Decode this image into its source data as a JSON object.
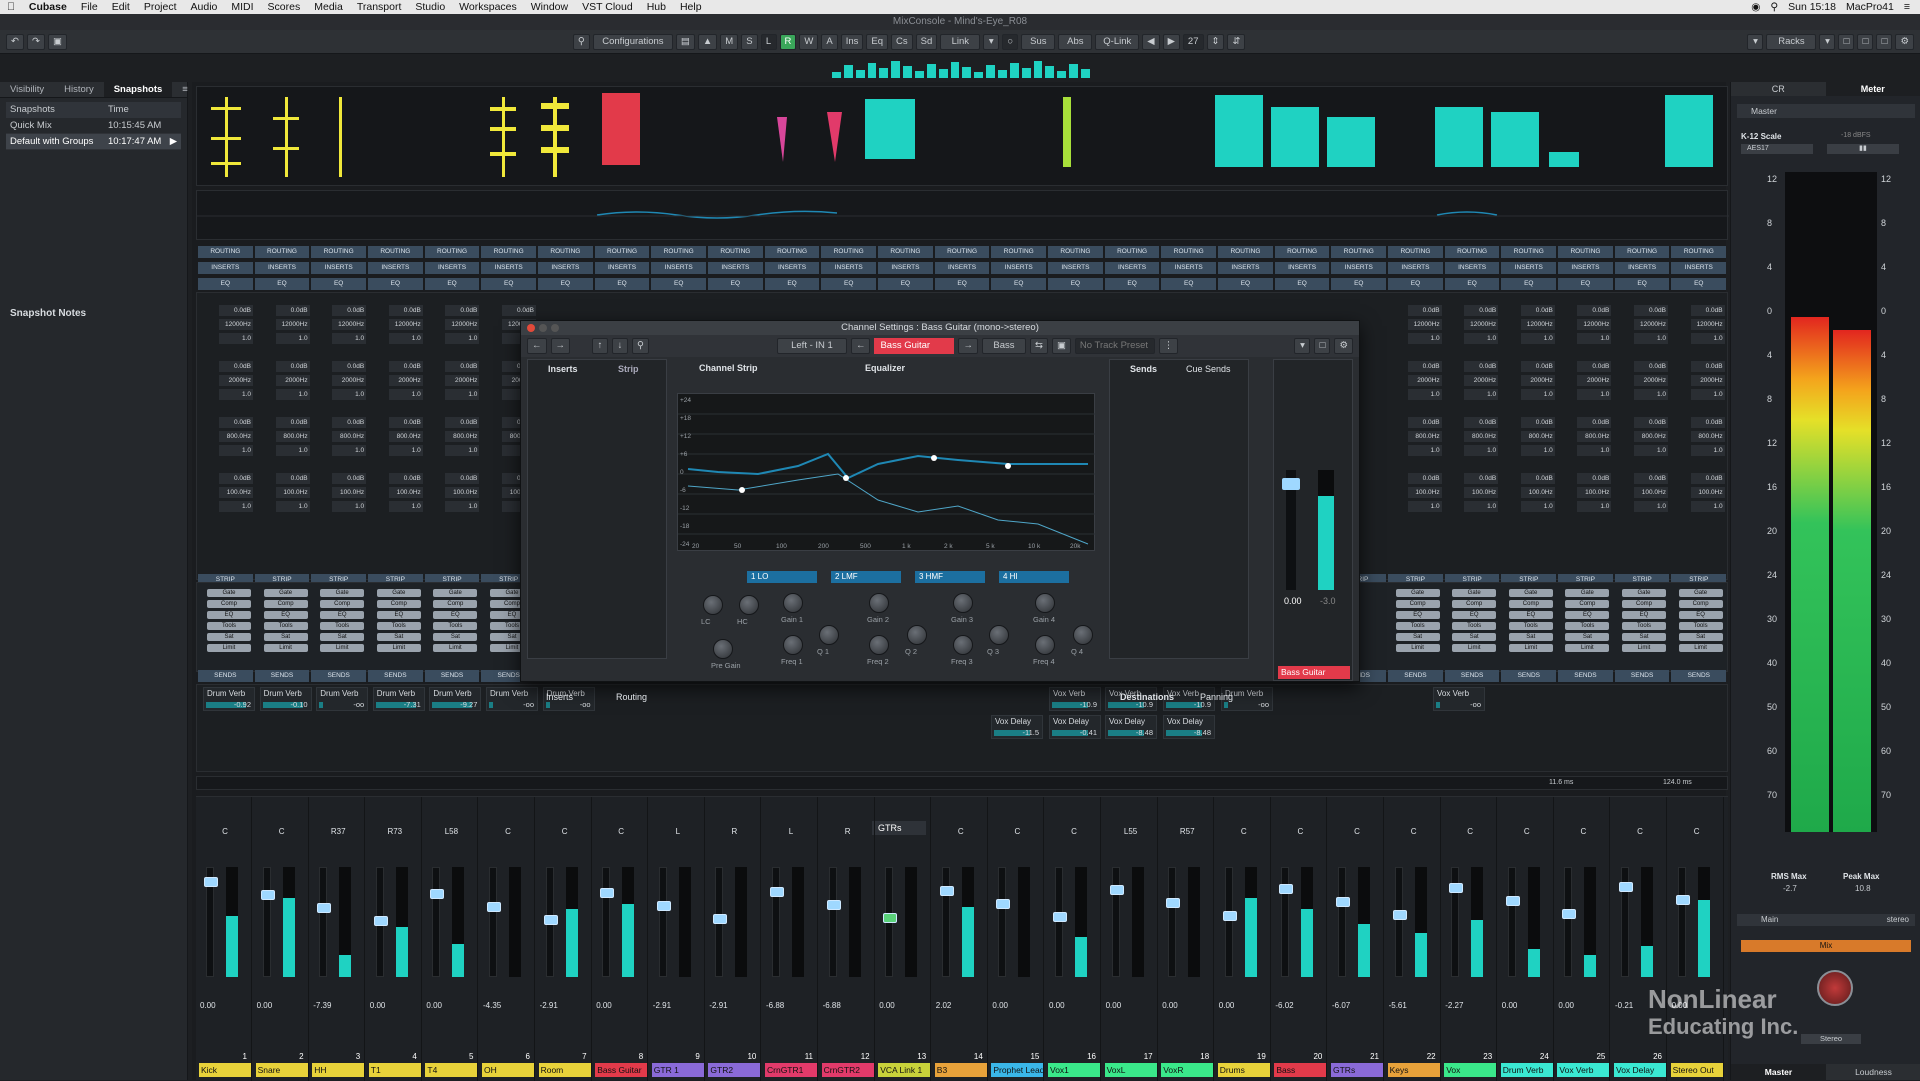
{
  "menubar": {
    "app": "Cubase",
    "items": [
      "File",
      "Edit",
      "Project",
      "Audio",
      "MIDI",
      "Scores",
      "Media",
      "Transport",
      "Studio",
      "Workspaces",
      "Window",
      "VST Cloud",
      "Hub",
      "Help"
    ],
    "clock": "Sun 15:18",
    "machine": "MacPro41"
  },
  "window_title": "MixConsole - Mind's-Eye_R08",
  "toolbar": {
    "configurations": "Configurations",
    "m": "M",
    "s": "S",
    "l": "L",
    "r": "R",
    "w": "W",
    "a": "A",
    "ins": "Ins",
    "eq": "Eq",
    "cs": "Cs",
    "sd": "Sd",
    "link": "Link",
    "sus": "Sus",
    "abs": "Abs",
    "qlink": "Q-Link",
    "count": "27",
    "racks": "Racks"
  },
  "left_panel": {
    "tabs": [
      "Visibility",
      "History",
      "Snapshots"
    ],
    "active_tab": "Snapshots",
    "col_snapshots": "Snapshots",
    "col_time": "Time",
    "rows": [
      {
        "name": "Quick Mix",
        "time": "10:15:45 AM"
      },
      {
        "name": "Default with Groups",
        "time": "10:17:47 AM"
      }
    ],
    "notes_label": "Snapshot Notes"
  },
  "rack_labels": {
    "routing": "ROUTING",
    "inserts": "INSERTS",
    "eq": "EQ",
    "strip": "STRIP",
    "sends": "SENDS"
  },
  "eq_cells": {
    "gain": "0.0dB",
    "freq": "12000Hz",
    "freq2": "2000Hz",
    "freq3": "800.0Hz",
    "freq4": "100.0Hz",
    "q": "1.0"
  },
  "strip_buttons": [
    "Gate",
    "Comp",
    "EQ",
    "Tools",
    "Sat",
    "Limit"
  ],
  "sends": {
    "drum_verb": "Drum Verb",
    "vox_delay": "Vox Delay",
    "vox_verb": "Vox Verb",
    "items": [
      {
        "name": "Drum Verb",
        "value": "-0.92"
      },
      {
        "name": "Drum Verb",
        "value": "-0.10"
      },
      {
        "name": "Drum Verb",
        "value": "-oo"
      },
      {
        "name": "Drum Verb",
        "value": "-7.31"
      },
      {
        "name": "Drum Verb",
        "value": "-9.27"
      },
      {
        "name": "Drum Verb",
        "value": "-oo"
      },
      {
        "name": "Drum Verb",
        "value": "-oo"
      }
    ],
    "right_items": [
      {
        "name": "Vox Delay",
        "value": "-11.5"
      },
      {
        "name": "Vox Delay",
        "value": "-0.41"
      },
      {
        "name": "Vox Verb",
        "value": "-10.9"
      },
      {
        "name": "Vox Delay",
        "value": "-8.48"
      },
      {
        "name": "Vox Verb",
        "value": "-10.9"
      },
      {
        "name": "Vox Delay",
        "value": "-8.48"
      },
      {
        "name": "Vox Verb",
        "value": "-10.9"
      },
      {
        "name": "Drum Verb",
        "value": "-oo"
      },
      {
        "name": "Vox Verb",
        "value": "-oo"
      }
    ]
  },
  "dialog": {
    "title": "Channel Settings : Bass Guitar (mono->stereo)",
    "input": "Left - IN 1",
    "track": "Bass Guitar",
    "preset_target": "Bass",
    "track_preset": "No Track Preset",
    "tabs_left": [
      "Inserts",
      "Strip"
    ],
    "section_strip": "Channel Strip",
    "section_eq": "Equalizer",
    "section_sends": "Sends",
    "section_cue": "Cue Sends",
    "bottom_left": [
      "Inserts",
      "Routing"
    ],
    "bottom_right": [
      "Destinations",
      "Panning"
    ],
    "bands": [
      "1 LO",
      "2 LMF",
      "3 HMF",
      "4 HI"
    ],
    "knob_labels": [
      "LC",
      "HC",
      "Pre Gain",
      "Gain 1",
      "Freq 1",
      "Q 1",
      "Gain 2",
      "Freq 2",
      "Q 2",
      "Gain 3",
      "Freq 3",
      "Q 3",
      "Gain 4",
      "Freq 4",
      "Q 4"
    ],
    "dB_ticks": [
      "+24",
      "+18",
      "+12",
      "+6",
      "0",
      "-6",
      "-12",
      "-18",
      "-24"
    ],
    "hz_ticks": [
      "20",
      "50",
      "100",
      "200",
      "500",
      "1 k",
      "2 k",
      "5 k",
      "10 k",
      "20k"
    ],
    "fader_value": "0.00",
    "fader_value2": "-3.0",
    "channel_name": "Bass Guitar"
  },
  "channels": [
    {
      "name": "Kick",
      "num": "1",
      "pan": "C",
      "vol": "0.00",
      "color": "#e8d23a",
      "level": 0.55
    },
    {
      "name": "Snare",
      "num": "2",
      "pan": "C",
      "vol": "0.00",
      "color": "#e8d23a",
      "level": 0.72
    },
    {
      "name": "HH",
      "num": "3",
      "pan": "R37",
      "vol": "-7.39",
      "color": "#e8d23a",
      "level": 0.2
    },
    {
      "name": "T1",
      "num": "4",
      "pan": "R73",
      "vol": "0.00",
      "color": "#e8d23a",
      "level": 0.45
    },
    {
      "name": "T4",
      "num": "5",
      "pan": "L58",
      "vol": "0.00",
      "color": "#e8d23a",
      "level": 0.3
    },
    {
      "name": "OH",
      "num": "6",
      "pan": "C",
      "vol": "-4.35",
      "color": "#e8d23a",
      "level": 0.0
    },
    {
      "name": "Room",
      "num": "7",
      "pan": "C",
      "vol": "-2.91",
      "color": "#e8d23a",
      "level": 0.62
    },
    {
      "name": "Bass Guitar",
      "num": "8",
      "pan": "C",
      "vol": "0.00",
      "color": "#e23a4a",
      "level": 0.66
    },
    {
      "name": "GTR 1",
      "num": "9",
      "pan": "L",
      "vol": "-2.91",
      "color": "#8a6ad8",
      "level": 0.0
    },
    {
      "name": "GTR2",
      "num": "10",
      "pan": "R",
      "vol": "-2.91",
      "color": "#8a6ad8",
      "level": 0.0
    },
    {
      "name": "CrnGTR1",
      "num": "11",
      "pan": "L",
      "vol": "-6.88",
      "color": "#e23a6a",
      "level": 0.0
    },
    {
      "name": "CrnGTR2",
      "num": "12",
      "pan": "R",
      "vol": "-6.88",
      "color": "#e23a6a",
      "level": 0.0
    },
    {
      "name": "VCA Link 1",
      "num": "13",
      "pan": "",
      "vol": "0.00",
      "color": "#c8d23a",
      "level": 0.0
    },
    {
      "name": "B3",
      "num": "14",
      "pan": "C",
      "vol": "2.02",
      "color": "#e8a23a",
      "level": 0.64
    },
    {
      "name": "Prophet Lead",
      "num": "15",
      "pan": "C",
      "vol": "0.00",
      "color": "#3ab6e8",
      "level": 0.0
    },
    {
      "name": "Vox1",
      "num": "16",
      "pan": "C",
      "vol": "0.00",
      "color": "#3ae88a",
      "level": 0.36
    },
    {
      "name": "VoxL",
      "num": "17",
      "pan": "L55",
      "vol": "0.00",
      "color": "#3ae88a",
      "level": 0.0
    },
    {
      "name": "VoxR",
      "num": "18",
      "pan": "R57",
      "vol": "0.00",
      "color": "#3ae88a",
      "level": 0.0
    },
    {
      "name": "Drums",
      "num": "19",
      "pan": "C",
      "vol": "0.00",
      "color": "#e8d23a",
      "level": 0.72
    },
    {
      "name": "Bass",
      "num": "20",
      "pan": "C",
      "vol": "-6.02",
      "color": "#e23a4a",
      "level": 0.62
    },
    {
      "name": "GTRs",
      "num": "21",
      "pan": "C",
      "vol": "-6.07",
      "color": "#8a6ad8",
      "level": 0.48
    },
    {
      "name": "Keys",
      "num": "22",
      "pan": "C",
      "vol": "-5.61",
      "color": "#e8a23a",
      "level": 0.4
    },
    {
      "name": "Vox",
      "num": "23",
      "pan": "C",
      "vol": "-2.27",
      "color": "#3ae88a",
      "level": 0.52
    },
    {
      "name": "Drum Verb",
      "num": "24",
      "pan": "C",
      "vol": "0.00",
      "color": "#3ae8d2",
      "level": 0.25
    },
    {
      "name": "Vox Verb",
      "num": "25",
      "pan": "C",
      "vol": "0.00",
      "color": "#3ae8d2",
      "level": 0.2
    },
    {
      "name": "Vox Delay",
      "num": "26",
      "pan": "C",
      "vol": "-0.21",
      "color": "#3ae8d2",
      "level": 0.28
    },
    {
      "name": "Stereo Out",
      "num": "",
      "pan": "C",
      "vol": "0.00",
      "color": "#e8d23a",
      "level": 0.7
    }
  ],
  "group_label": "GTRs",
  "right_panel": {
    "tabs": [
      "CR",
      "Meter"
    ],
    "active_tab": "Meter",
    "master": "Master",
    "scale_name": "K-12 Scale",
    "scale_ref": "-18 dBFS",
    "aes": "AES17",
    "ticks": [
      "12",
      "8",
      "4",
      "0",
      "4",
      "8",
      "12",
      "16",
      "20",
      "24",
      "30",
      "40",
      "50",
      "60",
      "70"
    ],
    "rms_label": "RMS Max",
    "rms_value": "-2.7",
    "peak_label": "Peak Max",
    "peak_value": "10.8",
    "main": "Main",
    "main_format": "stereo",
    "mix": "Mix",
    "output": "Stereo",
    "master_tab": "Master",
    "loudness_tab": "Loudness",
    "left_level": 0.78,
    "right_level": 0.76
  },
  "latency": {
    "a": "11.6 ms",
    "b": "124.0 ms"
  },
  "watermark": {
    "line1": "NonLinear",
    "line2": "Educating Inc."
  }
}
